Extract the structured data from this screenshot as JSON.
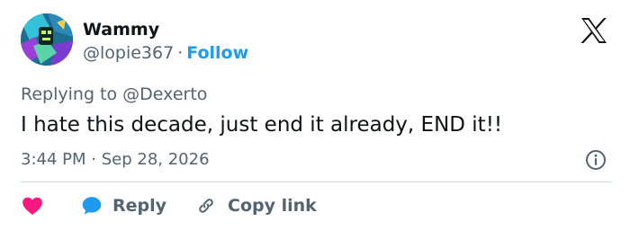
{
  "author": {
    "name": "Wammy",
    "handle": "@lopie367",
    "separator": "·",
    "follow_label": "Follow"
  },
  "reply_context": {
    "prefix": "Replying to",
    "mention": "@Dexerto"
  },
  "tweet": {
    "text": "I hate this decade, just end it already, END it!!"
  },
  "meta": {
    "time": "3:44 PM",
    "separator": "·",
    "date": "Sep 28, 2026"
  },
  "actions": {
    "like_icon": "heart-icon",
    "reply_label": "Reply",
    "reply_icon": "speech-bubble-icon",
    "copy_link_label": "Copy link",
    "copy_link_icon": "link-icon"
  },
  "colors": {
    "accent": "#1d9bf0",
    "muted_text": "#536471",
    "heart": "#f91880",
    "divider": "#cfd9de"
  },
  "icons": {
    "logo": "x-logo-icon",
    "info": "info-icon"
  }
}
